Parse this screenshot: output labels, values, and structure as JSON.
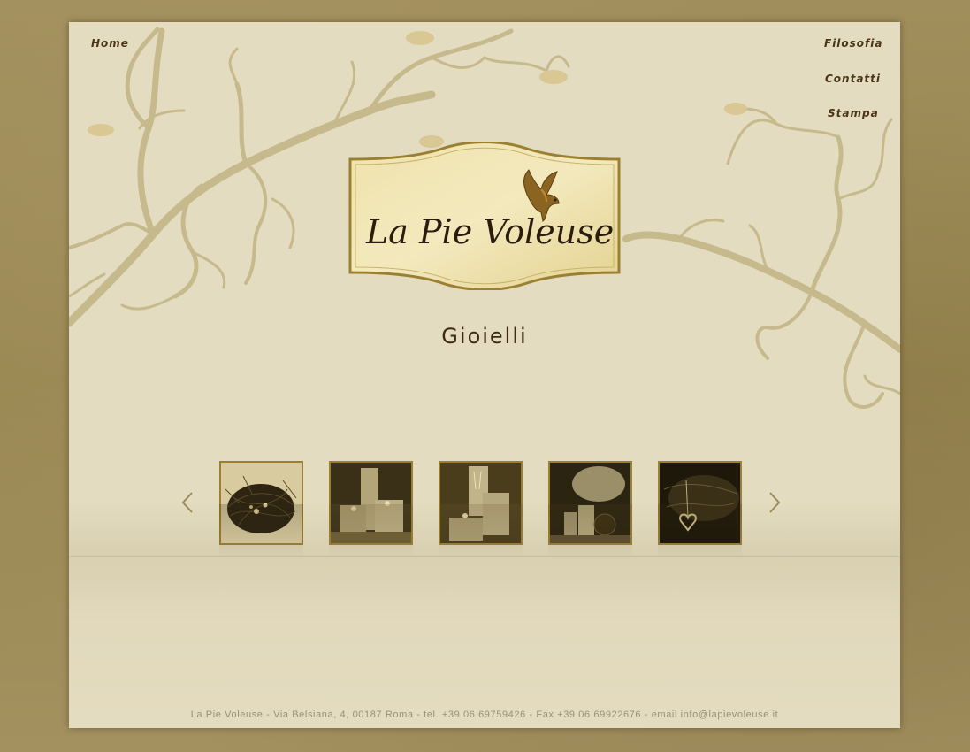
{
  "nav": {
    "home": "Home",
    "filosofia": "Filosofia",
    "contatti": "Contatti",
    "stampa": "Stampa"
  },
  "logo": {
    "text": "La Pie Voleuse",
    "icon": "magpie-bird-icon"
  },
  "subtitle": "Gioielli",
  "gallery": {
    "prev_icon": "chevron-left-icon",
    "next_icon": "chevron-right-icon",
    "thumbnails": [
      {
        "name": "nest-jewelry-photo"
      },
      {
        "name": "display-cubes-photo"
      },
      {
        "name": "display-cubes-necklace-photo"
      },
      {
        "name": "shop-window-display-photo"
      },
      {
        "name": "heart-necklace-photo"
      }
    ]
  },
  "footer": "La Pie Voleuse - Via Belsiana, 4, 00187 Roma - tel. +39 06 69759426 - Fax +39 06 69922676 - email info@lapievoleuse.it",
  "colors": {
    "background": "#9c8a58",
    "page": "#e4dcc0",
    "branch": "#c4b688",
    "text_dark": "#4a3518",
    "thumb_border": "#9c8032"
  }
}
